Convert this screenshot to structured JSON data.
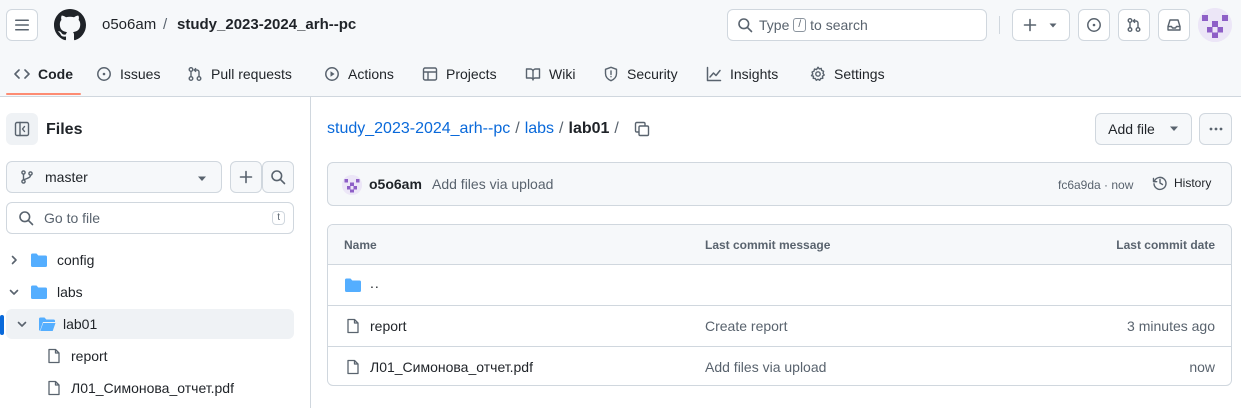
{
  "header": {
    "owner": "o5o6am",
    "separator": "/",
    "repo": "study_2023-2024_arh--pc",
    "search": {
      "prefix": "Type",
      "key": "/",
      "suffix": "to search"
    }
  },
  "tabs": [
    {
      "label": "Code",
      "icon": "code-icon",
      "active": true
    },
    {
      "label": "Issues",
      "icon": "issue-opened-icon"
    },
    {
      "label": "Pull requests",
      "icon": "git-pull-request-icon"
    },
    {
      "label": "Actions",
      "icon": "play-icon"
    },
    {
      "label": "Projects",
      "icon": "table-icon"
    },
    {
      "label": "Wiki",
      "icon": "book-icon"
    },
    {
      "label": "Security",
      "icon": "shield-icon"
    },
    {
      "label": "Insights",
      "icon": "graph-icon"
    },
    {
      "label": "Settings",
      "icon": "gear-icon"
    }
  ],
  "sidebar": {
    "title": "Files",
    "branch": "master",
    "goto_placeholder": "Go to file",
    "goto_key": "t",
    "tree": [
      {
        "label": "config",
        "type": "folder",
        "expanded": false,
        "depth": 0
      },
      {
        "label": "labs",
        "type": "folder",
        "expanded": true,
        "depth": 0
      },
      {
        "label": "lab01",
        "type": "folder",
        "expanded": true,
        "depth": 1,
        "selected": true
      },
      {
        "label": "report",
        "type": "file",
        "depth": 2
      },
      {
        "label": "Л01_Симонова_отчет.pdf",
        "type": "file",
        "depth": 2
      }
    ]
  },
  "main": {
    "path": {
      "repo_link": "study_2023-2024_arh--pc",
      "folder_link": "labs",
      "current": "lab01",
      "sep": "/"
    },
    "add_file": "Add file",
    "commit": {
      "author": "o5o6am",
      "message": "Add files via upload",
      "hash_time": "fc6a9da · now",
      "history": "History"
    },
    "table": {
      "headers": [
        "Name",
        "Last commit message",
        "Last commit date"
      ],
      "parent": "..",
      "rows": [
        {
          "name": "report",
          "message": "Create report",
          "date": "3 minutes ago"
        },
        {
          "name": "Л01_Симонова_отчет.pdf",
          "message": "Add files via upload",
          "date": "now"
        }
      ]
    }
  },
  "colors": {
    "accent": "#0969da",
    "folder": "#54aeff",
    "tab_underline": "#fd8c73",
    "border": "#d0d7de",
    "muted": "#59636e"
  }
}
